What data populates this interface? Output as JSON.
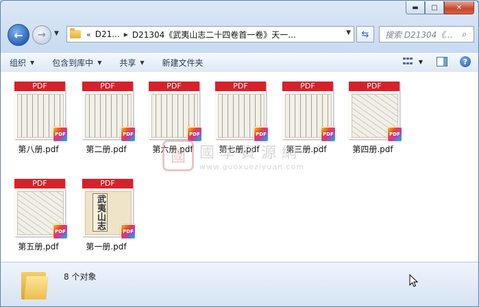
{
  "window": {
    "caption_buttons": {
      "minimize": "▬",
      "maximize": "□",
      "close": "✕"
    }
  },
  "nav": {
    "back_icon": "arrow-left-icon",
    "forward_icon": "arrow-right-icon",
    "address": {
      "prefix": "«",
      "crumbs": [
        "D21...",
        "D21304《武夷山志二十四卷首一卷》天一..."
      ]
    },
    "search_placeholder": "搜索 D21304《..."
  },
  "toolbar": {
    "items": [
      {
        "label": "组织"
      },
      {
        "label": "包含到库中"
      },
      {
        "label": "共享"
      },
      {
        "label": "新建文件夹"
      }
    ]
  },
  "files": [
    {
      "name": "第八册.pdf",
      "banner": "PDF",
      "badge": "PDF",
      "thumb": "text"
    },
    {
      "name": "第二册.pdf",
      "banner": "PDF",
      "badge": "PDF",
      "thumb": "text"
    },
    {
      "name": "第六册.pdf",
      "banner": "PDF",
      "badge": "PDF",
      "thumb": "text"
    },
    {
      "name": "第七册.pdf",
      "banner": "PDF",
      "badge": "PDF",
      "thumb": "text"
    },
    {
      "name": "第三册.pdf",
      "banner": "PDF",
      "badge": "PDF",
      "thumb": "text"
    },
    {
      "name": "第四册.pdf",
      "banner": "PDF",
      "badge": "PDF",
      "thumb": "sketch"
    },
    {
      "name": "第五册.pdf",
      "banner": "PDF",
      "badge": "PDF",
      "thumb": "sketch"
    },
    {
      "name": "第一册.pdf",
      "banner": "PDF",
      "badge": "PDF",
      "thumb": "cover",
      "cover_label": "武夷山志"
    }
  ],
  "watermark": {
    "seal": "國",
    "title": "國學資源網",
    "url": "www.guoxueziyuan.com"
  },
  "status": {
    "count_text": "8 个对象"
  }
}
